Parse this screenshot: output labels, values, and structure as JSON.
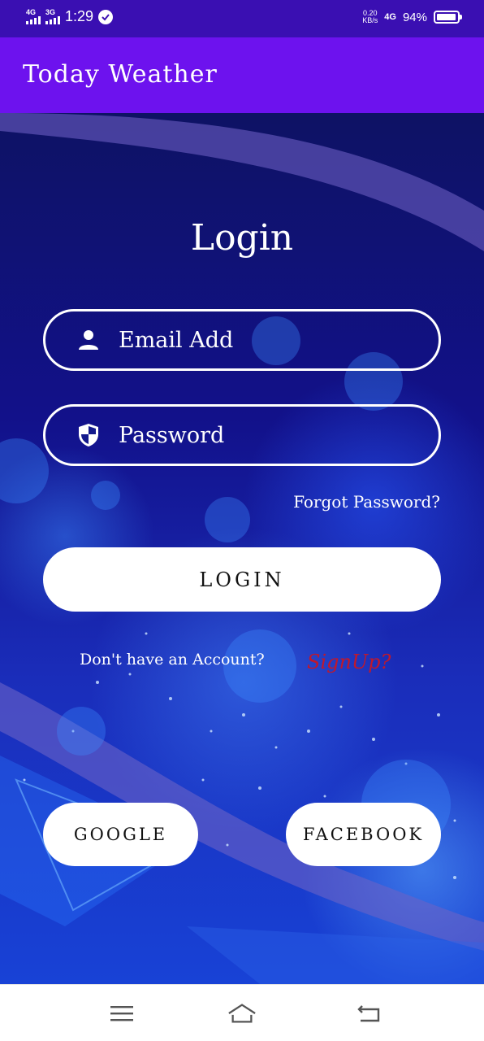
{
  "status_bar": {
    "sim1_network": "4G",
    "sim2_network": "3G",
    "time": "1:29",
    "data_speed_value": "0.20",
    "data_speed_unit": "KB/s",
    "network_type": "4G",
    "battery_percent": "94%",
    "battery_level": 0.94
  },
  "app_bar": {
    "title": "Today Weather",
    "color": "#6d12ee"
  },
  "login": {
    "title": "Login",
    "email_placeholder": "Email Add",
    "password_placeholder": "Password",
    "forgot_password": "Forgot Password?",
    "login_button": "LOGIN",
    "no_account_text": "Don't have an Account?",
    "signup_link": "SignUp?",
    "google_button": "GOOGLE",
    "facebook_button": "FACEBOOK"
  },
  "icons": {
    "email_icon": "person-icon",
    "password_icon": "shield-icon"
  },
  "nav_bar": {
    "menu_icon": "menu-icon",
    "home_icon": "home-icon",
    "back_icon": "back-icon"
  },
  "colors": {
    "signup": "#c0182c",
    "status_bar": "#3a0fb2"
  }
}
